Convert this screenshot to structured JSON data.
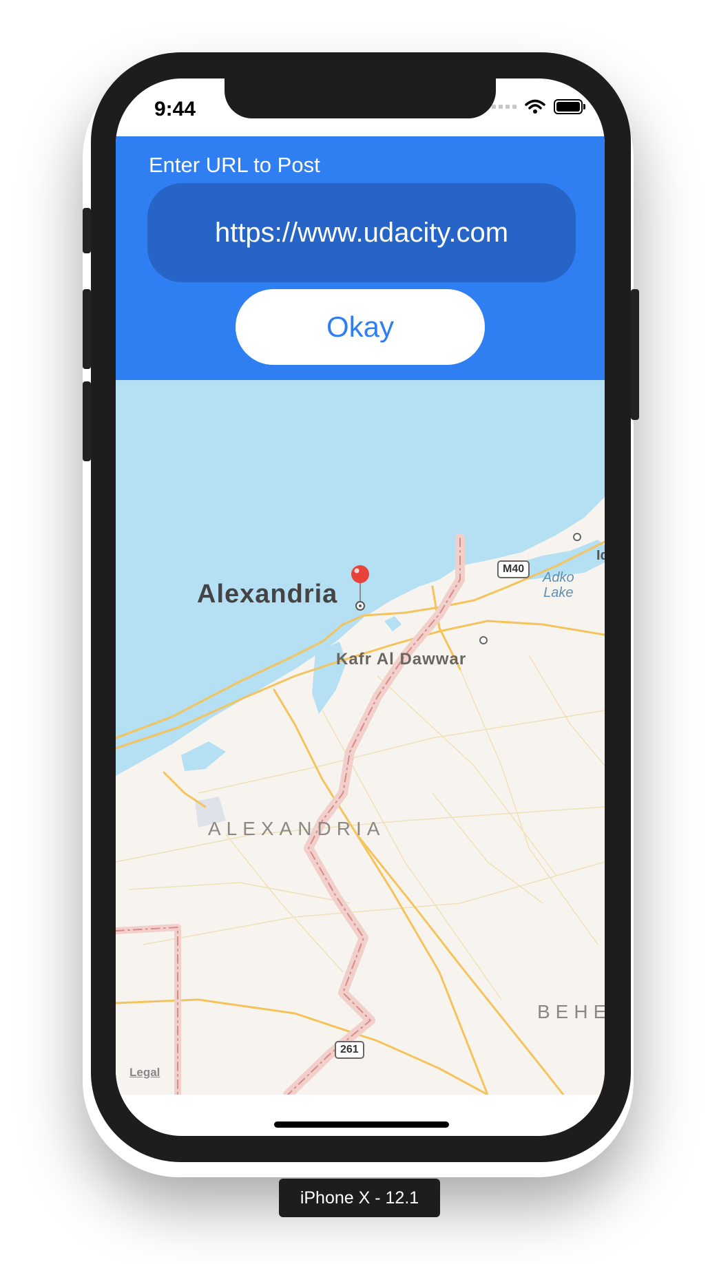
{
  "status_bar": {
    "time": "9:44"
  },
  "form": {
    "label": "Enter URL to Post",
    "url_value": "https://www.udacity.com",
    "okay_label": "Okay"
  },
  "map": {
    "labels": {
      "alexandria_city": "Alexandria",
      "kafr_al_dawwar": "Kafr Al Dawwar",
      "alexandria_region": "ALEXANDRIA",
      "beheira_region": "BEHE",
      "adko_lake_line1": "Adko",
      "adko_lake_line2": "Lake",
      "edge_label": "Id"
    },
    "road_shields": {
      "m40": "M40",
      "r261": "261"
    },
    "legal": "Legal"
  },
  "device": {
    "caption": "iPhone X - 12.1"
  },
  "colors": {
    "header": "#2f7ff2",
    "field": "#2664c8",
    "sea": "#b5dff2",
    "land": "#f7f4ef",
    "road": "#f5c35b",
    "border": "#e7a8a4"
  }
}
